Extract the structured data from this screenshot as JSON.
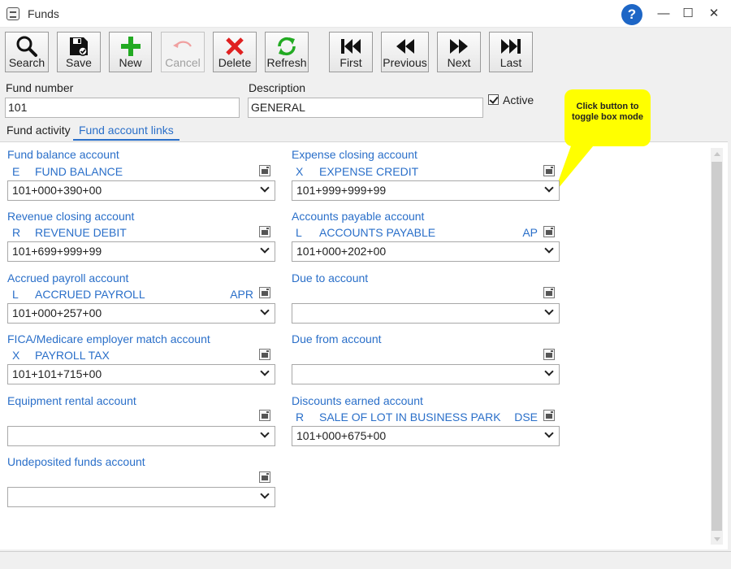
{
  "window": {
    "title": "Funds",
    "help": "?",
    "minimize": "—",
    "maximize": "☐",
    "close": "✕"
  },
  "toolbar": {
    "search": "Search",
    "save": "Save",
    "new": "New",
    "cancel": "Cancel",
    "delete": "Delete",
    "refresh": "Refresh",
    "first": "First",
    "previous": "Previous",
    "next": "Next",
    "last": "Last"
  },
  "header": {
    "fund_number_label": "Fund number",
    "fund_number_value": "101",
    "description_label": "Description",
    "description_value": "GENERAL",
    "active_label": "Active"
  },
  "tabs": [
    {
      "label": "Fund activity"
    },
    {
      "label": "Fund account links"
    }
  ],
  "callout": {
    "text": "Click button to toggle box mode"
  },
  "accounts": {
    "fund_balance": {
      "title": "Fund balance account",
      "code": "E",
      "desc": "FUND BALANCE",
      "abbr": "",
      "value": "101+000+390+00"
    },
    "revenue_closing": {
      "title": "Revenue closing account",
      "code": "R",
      "desc": "REVENUE DEBIT",
      "abbr": "",
      "value": "101+699+999+99"
    },
    "accrued_payroll": {
      "title": "Accrued payroll account",
      "code": "L",
      "desc": "ACCRUED PAYROLL",
      "abbr": "APR",
      "value": "101+000+257+00"
    },
    "fica": {
      "title": "FICA/Medicare employer match account",
      "code": "X",
      "desc": "PAYROLL TAX",
      "abbr": "",
      "value": "101+101+715+00"
    },
    "equipment_rental": {
      "title": "Equipment rental account",
      "code": "",
      "desc": "",
      "abbr": "",
      "value": ""
    },
    "undeposited": {
      "title": "Undeposited funds account",
      "code": "",
      "desc": "",
      "abbr": "",
      "value": ""
    },
    "expense_closing": {
      "title": "Expense closing account",
      "code": "X",
      "desc": "EXPENSE CREDIT",
      "abbr": "",
      "value": "101+999+999+99"
    },
    "accounts_payable": {
      "title": "Accounts payable account",
      "code": "L",
      "desc": "ACCOUNTS PAYABLE",
      "abbr": "AP",
      "value": "101+000+202+00"
    },
    "due_to": {
      "title": "Due to account",
      "code": "",
      "desc": "",
      "abbr": "",
      "value": ""
    },
    "due_from": {
      "title": "Due from account",
      "code": "",
      "desc": "",
      "abbr": "",
      "value": ""
    },
    "discounts_earned": {
      "title": "Discounts earned account",
      "code": "R",
      "desc": "SALE OF LOT IN BUSINESS PARK",
      "abbr": "DSE",
      "value": "101+000+675+00"
    }
  },
  "colors": {
    "link_blue": "#2a6fc9",
    "help_blue": "#1d66c6",
    "callout_yellow": "#ffff00",
    "new_green": "#22aa22",
    "delete_red": "#e02020"
  }
}
